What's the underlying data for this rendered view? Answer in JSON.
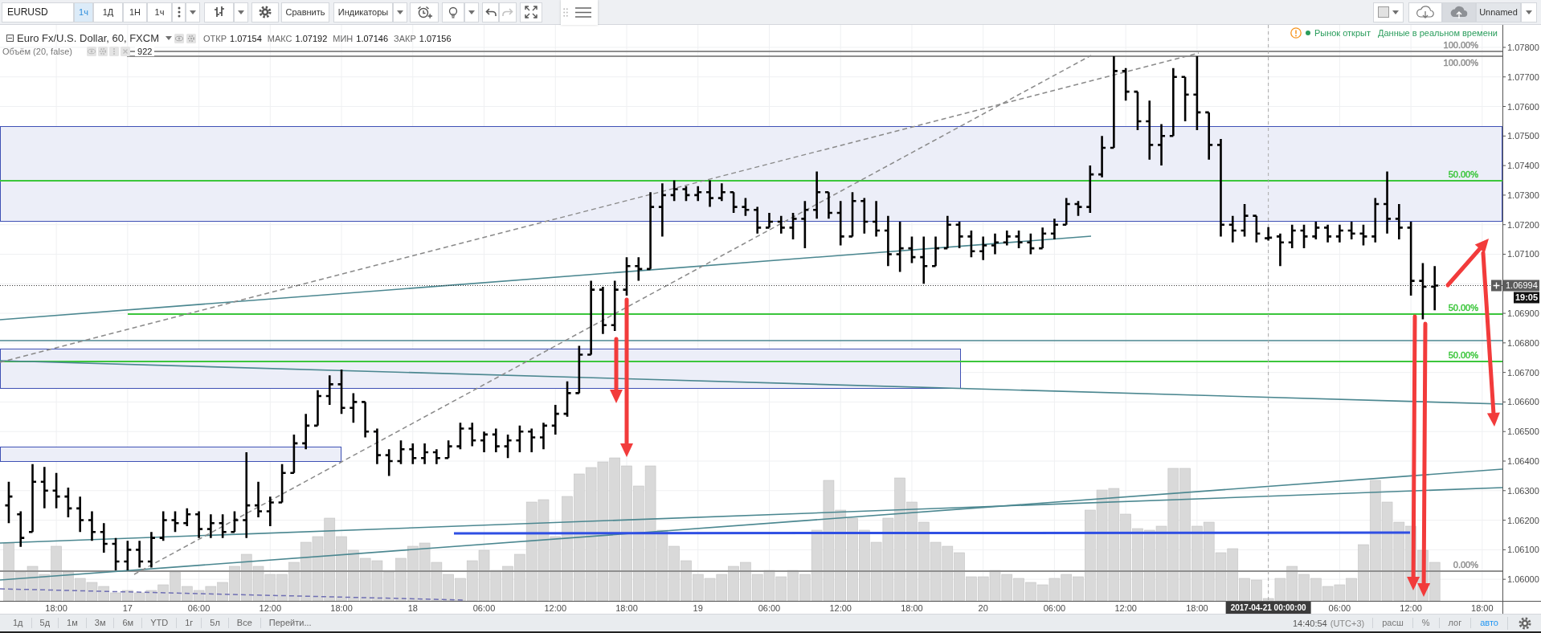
{
  "toolbar": {
    "symbol": "EURUSD",
    "intervals": [
      {
        "label": "1ч",
        "selected": true
      },
      {
        "label": "1Д",
        "selected": false
      },
      {
        "label": "1Н",
        "selected": false
      }
    ],
    "interval_menu": "1ч",
    "buttons": [
      {
        "label": "Сравнить",
        "kind": "plain"
      },
      {
        "label": "Индикаторы",
        "kind": "dropdown"
      }
    ],
    "history": [
      {
        "kind": "undo",
        "disabled": false
      },
      {
        "kind": "redo",
        "disabled": true
      }
    ],
    "layout_name": "Unnamed"
  },
  "legend": {
    "title": "Euro Fx/U.S. Dollar, 60, FXCM",
    "values": [
      {
        "label": "ОТКР",
        "value": "1.07154"
      },
      {
        "label": "МАКС",
        "value": "1.07192"
      },
      {
        "label": "МИН",
        "value": "1.07146"
      },
      {
        "label": "ЗАКР",
        "value": "1.07156"
      }
    ],
    "volume": {
      "title": "Объём (20, false)",
      "value": "922"
    }
  },
  "status": {
    "market": "Рынок открыт",
    "data": "Данные в реальном времени"
  },
  "chart": {
    "fib_labels": [
      {
        "text": "100.00%",
        "color": "#8f8f8f"
      },
      {
        "text": "100.00%",
        "color": "#8f8f8f"
      },
      {
        "text": "50.00%",
        "color": "#3cc63c"
      },
      {
        "text": "50.00%",
        "color": "#3cc63c"
      },
      {
        "text": "50.00%",
        "color": "#3cc63c"
      },
      {
        "text": "0.00%",
        "color": "#8f8f8f"
      }
    ]
  },
  "price_axis": {
    "labels": [
      "1.07800",
      "1.07700",
      "1.07600",
      "1.07500",
      "1.07400",
      "1.07300",
      "1.07200",
      "1.07100",
      "1.06900",
      "1.06800",
      "1.06700",
      "1.06600",
      "1.06500",
      "1.06400",
      "1.06300",
      "1.06200",
      "1.06100",
      "1.06000"
    ],
    "last_price": "1.06994",
    "countdown": "19:05"
  },
  "time_axis": {
    "labels": [
      "18:00",
      "17",
      "06:00",
      "12:00",
      "18:00",
      "18",
      "06:00",
      "12:00",
      "18:00",
      "19",
      "06:00",
      "12:00",
      "18:00",
      "20",
      "06:00",
      "12:00",
      "18:00",
      "06:00",
      "12:00",
      "18:00"
    ],
    "crosshair_time": "2017-04-21 00:00:00"
  },
  "bottom_bar": {
    "ranges": [
      "1д",
      "5д",
      "1м",
      "3м",
      "6м",
      "YTD",
      "1г",
      "5л",
      "Все"
    ],
    "goto": "Перейти...",
    "clock": "14:40:54",
    "timezone": "(UTC+3)",
    "scale_toggles": [
      {
        "label": "расш",
        "on": false
      },
      {
        "label": "%",
        "on": false
      },
      {
        "label": "лог",
        "on": false
      },
      {
        "label": "авто",
        "on": true
      }
    ]
  }
}
